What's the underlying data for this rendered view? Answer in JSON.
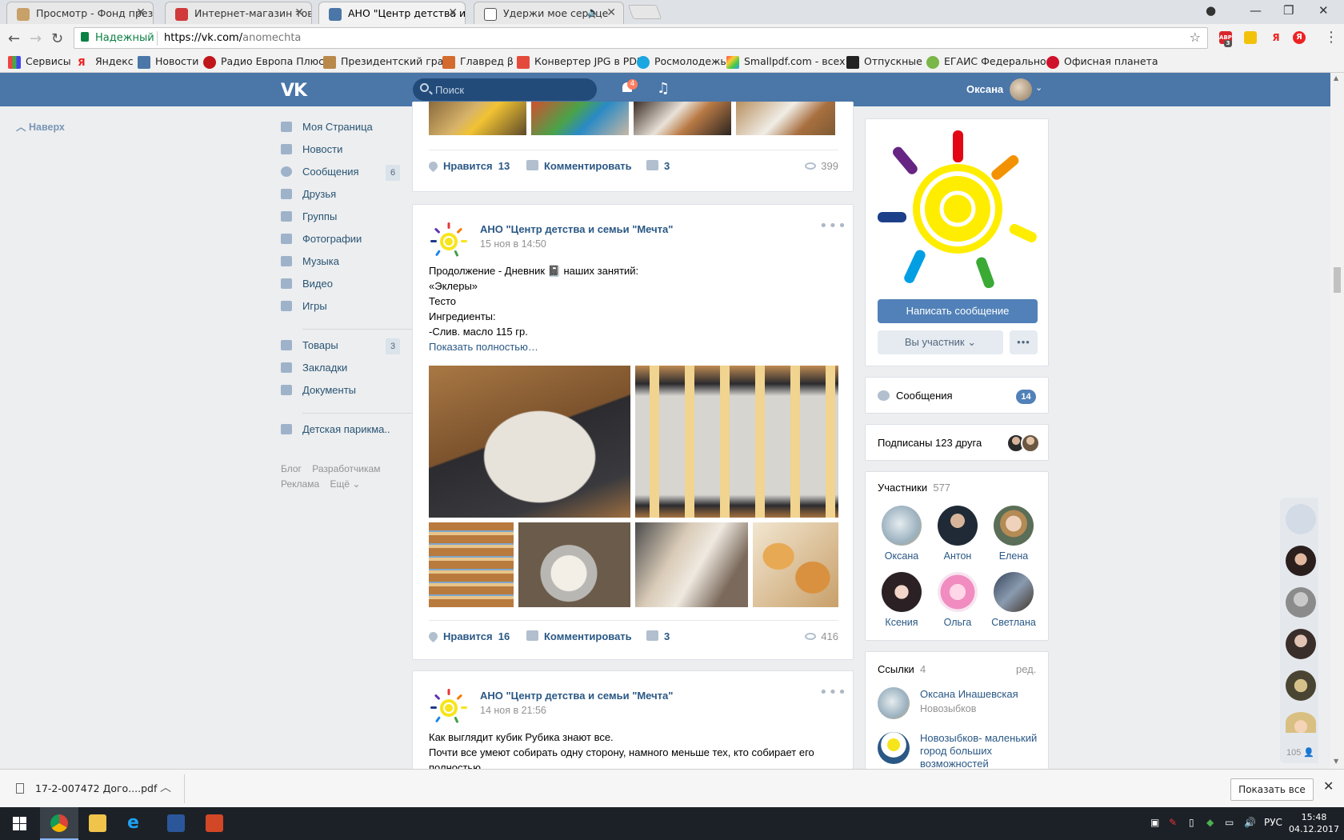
{
  "browser": {
    "tabs": [
      {
        "title": "Просмотр - Фонд прези"
      },
      {
        "title": "Интернет-магазин това"
      },
      {
        "title": "АНО \"Центр детства и с"
      },
      {
        "title": "Удержи мое сердце"
      }
    ],
    "secure_label": "Надежный",
    "url_scheme_host": "https://vk.com/",
    "url_path": "anomechta",
    "bookmarks": [
      "Сервисы",
      "Яндекс",
      "Новости",
      "Радио Европа Плюс",
      "Президентский гран",
      "Главред β",
      "Конвертер JPG в PDF",
      "Росмолодежь",
      "Smallpdf.com - всех",
      "Отпускные",
      "ЕГАИС Федерально",
      "Офисная планета"
    ],
    "ext_abp": "ABP",
    "ext_abp_count": "3",
    "ext_ya": "Я"
  },
  "vk": {
    "logo": "VK",
    "search_placeholder": "Поиск",
    "notifications_count": "4",
    "user_name": "Оксана",
    "back_to_top": "Наверх",
    "nav": [
      {
        "label": "Моя Страница"
      },
      {
        "label": "Новости"
      },
      {
        "label": "Сообщения",
        "count": "6"
      },
      {
        "label": "Друзья"
      },
      {
        "label": "Группы"
      },
      {
        "label": "Фотографии"
      },
      {
        "label": "Музыка"
      },
      {
        "label": "Видео"
      },
      {
        "label": "Игры"
      }
    ],
    "nav2": [
      {
        "label": "Товары",
        "count": "3"
      },
      {
        "label": "Закладки"
      },
      {
        "label": "Документы"
      }
    ],
    "nav3": [
      {
        "label": "Детская парикма.."
      }
    ],
    "footer_links": {
      "blog": "Блог",
      "dev": "Разработчикам",
      "ads": "Реклама",
      "more": "Ещё"
    }
  },
  "posts": [
    {
      "likes_label": "Нравится",
      "likes": "13",
      "comment_label": "Комментировать",
      "shares": "3",
      "views": "399"
    },
    {
      "author": "АНО \"Центр детства и семьи \"Мечта\"",
      "date": "15 ноя в 14:50",
      "lines": [
        "Продолжение - Дневник 📓 наших занятий:",
        "«Эклеры»",
        "Тесто",
        "Ингредиенты:",
        "-Слив. масло 115 гр."
      ],
      "show_more": "Показать полностью…",
      "likes_label": "Нравится",
      "likes": "16",
      "comment_label": "Комментировать",
      "shares": "3",
      "views": "416"
    },
    {
      "author": "АНО \"Центр детства и семьи \"Мечта\"",
      "date": "14 ноя в 21:56",
      "lines": [
        "Как выглядит кубик Рубика знают все.",
        "Почти все умеют собирать одну сторону, намного меньше тех, кто собирает его",
        "полностью."
      ]
    }
  ],
  "group": {
    "write_message": "Написать сообщение",
    "member_status": "Вы участник",
    "messages_label": "Сообщения",
    "messages_count": "14",
    "friends_subscribed": "Подписаны 123 друга",
    "members_label": "Участники",
    "members_count": "577",
    "members": [
      "Оксана",
      "Антон",
      "Елена",
      "Ксения",
      "Ольга",
      "Светлана"
    ],
    "links_label": "Ссылки",
    "links_count": "4",
    "links_edit": "ред.",
    "links": [
      {
        "title": "Оксана Инашевская",
        "subtitle": "Новозыбков"
      },
      {
        "title": "Новозыбков- маленький город больших возможностей",
        "subtitle": ""
      }
    ]
  },
  "chat_strip": {
    "online_count": "105"
  },
  "download_bar": {
    "file_name": "17-2-007472 Дого....pdf",
    "show_all": "Показать все"
  },
  "taskbar": {
    "lang": "РУС",
    "time": "15:48",
    "date": "04.12.2017"
  }
}
